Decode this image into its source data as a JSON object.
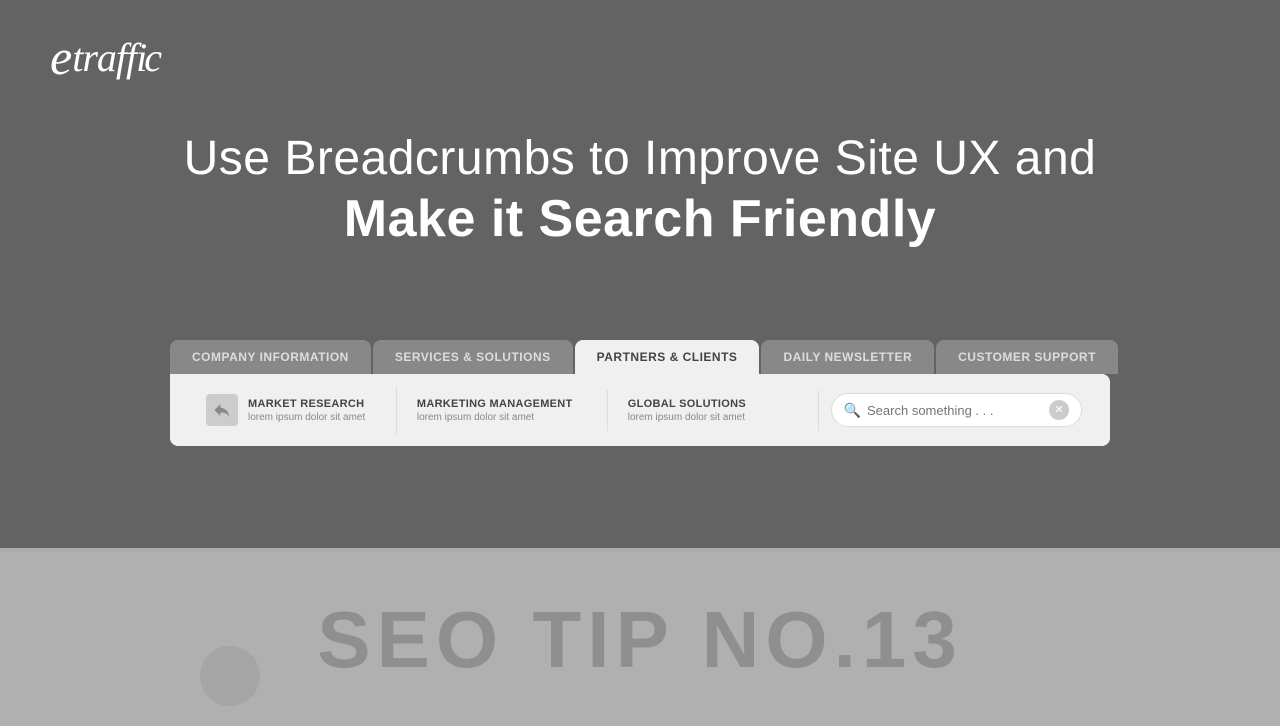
{
  "logo": {
    "text": "etraffic"
  },
  "headline": {
    "line1": "Use Breadcrumbs to Improve Site UX and",
    "line2": "Make it Search Friendly"
  },
  "tabs": [
    {
      "label": "COMPANY INFORMATION",
      "active": false
    },
    {
      "label": "SERVICES & SOLUTIONS",
      "active": false
    },
    {
      "label": "PARTNERS & CLIENTS",
      "active": true
    },
    {
      "label": "DAILY NEWSLETTER",
      "active": false
    },
    {
      "label": "CUSTOMER SUPPORT",
      "active": false
    }
  ],
  "nav_items": [
    {
      "title": "MARKET RESEARCH",
      "subtitle": "lorem ipsum dolor sit amet",
      "has_icon": true
    },
    {
      "title": "MARKETING MANAGEMENT",
      "subtitle": "lorem ipsum dolor sit amet",
      "has_icon": false
    },
    {
      "title": "GLOBAL SOLUTIONS",
      "subtitle": "lorem ipsum dolor sit amet",
      "has_icon": false
    }
  ],
  "search": {
    "placeholder": "Search something . . ."
  },
  "seo_tip": {
    "text": "SEO TIP NO.13"
  }
}
